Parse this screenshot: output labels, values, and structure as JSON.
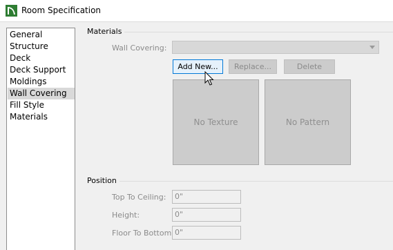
{
  "window": {
    "title": "Room Specification",
    "icon": "chief-architect-logo"
  },
  "sidebar": {
    "items": [
      {
        "label": "General"
      },
      {
        "label": "Structure"
      },
      {
        "label": "Deck"
      },
      {
        "label": "Deck Support"
      },
      {
        "label": "Moldings"
      },
      {
        "label": "Wall Covering",
        "selected": true
      },
      {
        "label": "Fill Style"
      },
      {
        "label": "Materials"
      }
    ]
  },
  "materials": {
    "group_label": "Materials",
    "wall_covering_label": "Wall Covering:",
    "wall_covering_value": "",
    "buttons": {
      "add_new": "Add New...",
      "replace": "Replace...",
      "delete": "Delete"
    },
    "texture_placeholder": "No Texture",
    "pattern_placeholder": "No Pattern"
  },
  "position": {
    "group_label": "Position",
    "top_to_ceiling_label": "Top To Ceiling:",
    "top_to_ceiling_value": "0\"",
    "height_label": "Height:",
    "height_value": "0\"",
    "floor_to_bottom_label": "Floor To Bottom:",
    "floor_to_bottom_value": "0\""
  },
  "colors": {
    "accent": "#0078d7",
    "logo_green": "#2e7d32",
    "disabled_fill": "#cccccc"
  }
}
